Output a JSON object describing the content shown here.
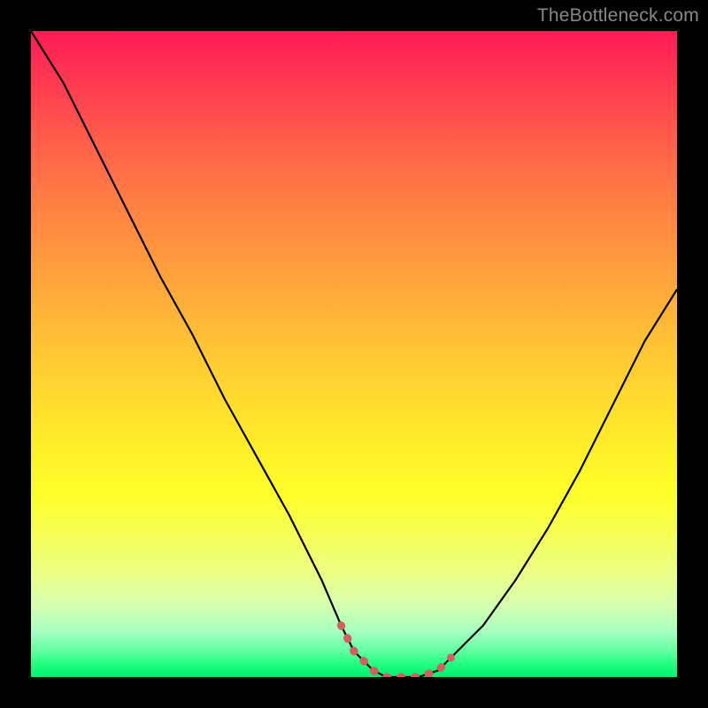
{
  "watermark": "TheBottleneck.com",
  "chart_data": {
    "type": "line",
    "title": "",
    "xlabel": "",
    "ylabel": "",
    "xlim": [
      0,
      100
    ],
    "ylim": [
      0,
      100
    ],
    "series": [
      {
        "name": "black-curve",
        "x": [
          0,
          5,
          10,
          15,
          20,
          25,
          30,
          35,
          40,
          45,
          48,
          50,
          53,
          55,
          58,
          60,
          63,
          65,
          70,
          75,
          80,
          85,
          90,
          95,
          100
        ],
        "values": [
          100,
          92,
          82,
          72,
          62,
          53,
          43,
          34,
          25,
          15,
          8,
          4,
          1,
          0,
          0,
          0,
          1,
          3,
          8,
          15,
          23,
          32,
          42,
          52,
          60
        ]
      },
      {
        "name": "highlight-band",
        "x": [
          48,
          50,
          53,
          55,
          58,
          60,
          63,
          65
        ],
        "values": [
          8,
          4,
          1,
          0,
          0,
          0,
          1,
          3
        ]
      }
    ],
    "background_gradient": {
      "top_color": "#ff1a55",
      "bottom_color": "#00f070",
      "direction": "vertical"
    }
  }
}
